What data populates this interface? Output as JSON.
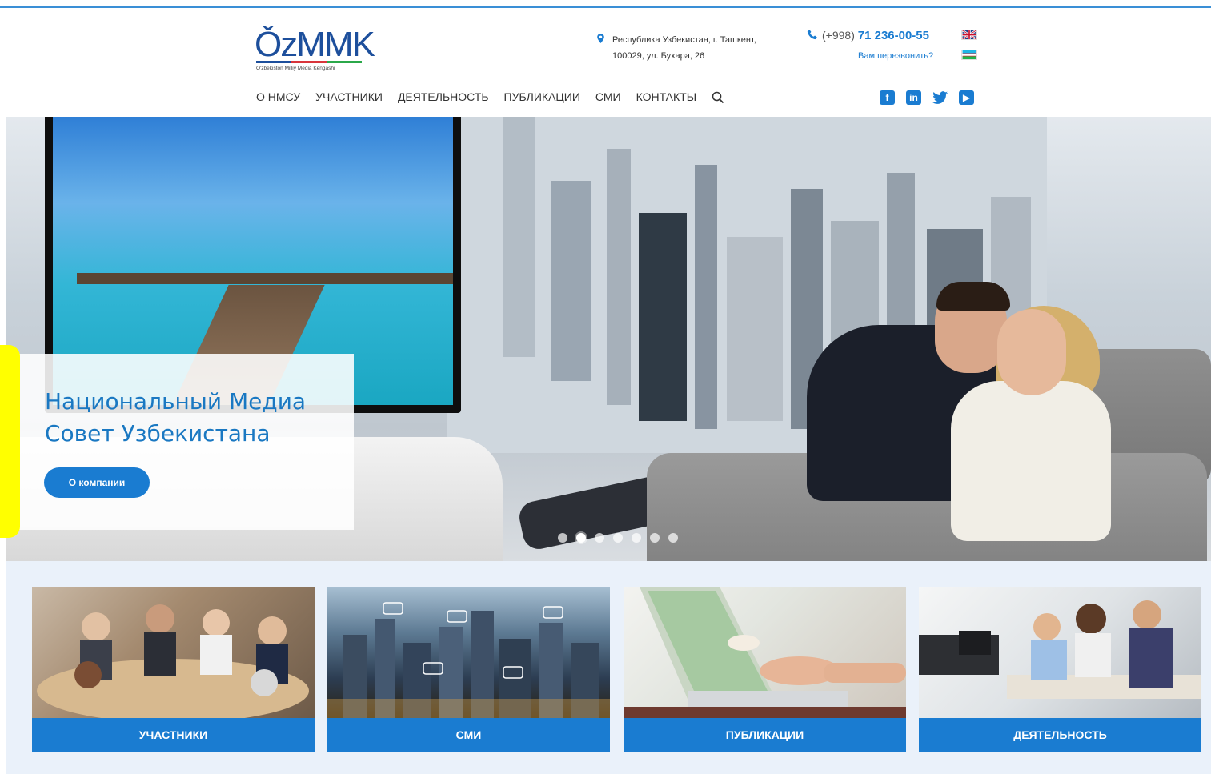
{
  "header": {
    "logo": {
      "mark": "ǑzMMK",
      "subtitle": "O'zbekiston Milliy Media Kengashi",
      "bar_colors": [
        "#1d4f9c",
        "#d9353b",
        "#2ba84a"
      ]
    },
    "address": {
      "line1": "Республика Узбекистан, г. Ташкент,",
      "line2": "100029, ул. Бухара, 26"
    },
    "phone": {
      "prefix": "(+998)",
      "number": "71 236-00-55",
      "callback": "Вам перезвонить?"
    },
    "languages": [
      {
        "code": "en",
        "icon": "uk-flag-icon"
      },
      {
        "code": "uz",
        "icon": "uzbekistan-flag-icon"
      }
    ],
    "nav": [
      {
        "label": "О НМСУ"
      },
      {
        "label": "УЧАСТНИКИ"
      },
      {
        "label": "ДЕЯТЕЛЬНОСТЬ"
      },
      {
        "label": "ПУБЛИКАЦИИ"
      },
      {
        "label": "СМИ"
      },
      {
        "label": "КОНТАКТЫ"
      }
    ],
    "social": [
      {
        "name": "facebook",
        "glyph": "f"
      },
      {
        "name": "linkedin",
        "glyph": "in"
      },
      {
        "name": "twitter",
        "glyph": ""
      },
      {
        "name": "youtube",
        "glyph": "▶"
      }
    ]
  },
  "hero": {
    "title": "Национальный Медиа Совет Узбекистана",
    "button_label": "О компании",
    "slides_total": 7,
    "active_slide": 2
  },
  "cards": [
    {
      "label": "УЧАСТНИКИ",
      "image": "meeting-photo"
    },
    {
      "label": "СМИ",
      "image": "city-chat-photo"
    },
    {
      "label": "ПУБЛИКАЦИИ",
      "image": "laptop-photo"
    },
    {
      "label": "ДЕЯТЕЛЬНОСТЬ",
      "image": "office-photo"
    }
  ],
  "colors": {
    "accent": "#1a7cd1",
    "title_blue": "#1a78c2",
    "strip_bg": "#eaf1fa",
    "highlight": "#ffff00"
  }
}
